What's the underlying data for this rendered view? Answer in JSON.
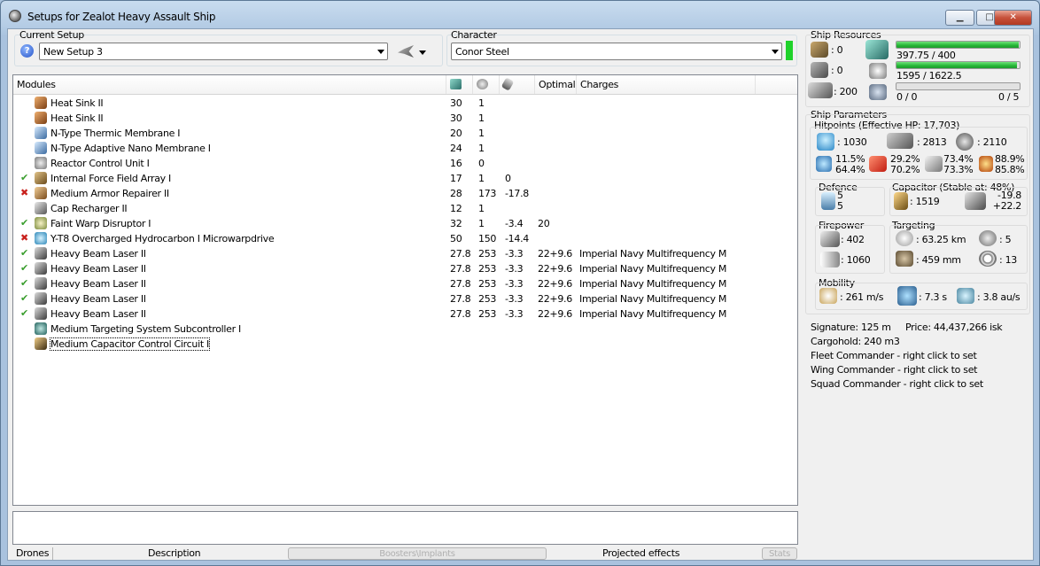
{
  "window": {
    "title": "Setups for Zealot Heavy Assault Ship",
    "minimize": "▁",
    "maximize": "□",
    "close": "✕"
  },
  "current_setup": {
    "label": "Current Setup",
    "value": "New Setup 3"
  },
  "character": {
    "label": "Character",
    "value": "Conor Steel",
    "indicator_color": "#1fd22a"
  },
  "modules": {
    "headers": {
      "name": "Modules",
      "optimal": "Optimal",
      "charges": "Charges"
    },
    "rows": [
      {
        "status": "",
        "icon": "heat-sink-icon",
        "name": "Heat Sink II",
        "cpu": "30",
        "power": "1",
        "cap": "",
        "optimal": "",
        "charges": ""
      },
      {
        "status": "",
        "icon": "heat-sink-icon",
        "name": "Heat Sink II",
        "cpu": "30",
        "power": "1",
        "cap": "",
        "optimal": "",
        "charges": ""
      },
      {
        "status": "",
        "icon": "membrane-icon",
        "name": "N-Type Thermic Membrane I",
        "cpu": "20",
        "power": "1",
        "cap": "",
        "optimal": "",
        "charges": ""
      },
      {
        "status": "",
        "icon": "membrane-icon",
        "name": "N-Type Adaptive Nano Membrane I",
        "cpu": "24",
        "power": "1",
        "cap": "",
        "optimal": "",
        "charges": ""
      },
      {
        "status": "",
        "icon": "reactor-control-icon",
        "name": "Reactor Control Unit I",
        "cpu": "16",
        "power": "0",
        "cap": "",
        "optimal": "",
        "charges": ""
      },
      {
        "status": "✔",
        "icon": "force-field-icon",
        "name": "Internal Force Field Array I",
        "cpu": "17",
        "power": "1",
        "cap": "0",
        "optimal": "",
        "charges": ""
      },
      {
        "status": "✖",
        "icon": "armor-repairer-icon",
        "name": "Medium Armor Repairer II",
        "cpu": "28",
        "power": "173",
        "cap": "-17.8",
        "optimal": "",
        "charges": ""
      },
      {
        "status": "",
        "icon": "cap-recharger-icon",
        "name": "Cap Recharger II",
        "cpu": "12",
        "power": "1",
        "cap": "",
        "optimal": "",
        "charges": ""
      },
      {
        "status": "✔",
        "icon": "warp-disruptor-icon",
        "name": "Faint Warp Disruptor I",
        "cpu": "32",
        "power": "1",
        "cap": "-3.4",
        "optimal": "20",
        "charges": ""
      },
      {
        "status": "✖",
        "icon": "microwarpdrive-icon",
        "name": "Y-T8 Overcharged Hydrocarbon I Microwarpdrive",
        "cpu": "50",
        "power": "150",
        "cap": "-14.4",
        "optimal": "",
        "charges": ""
      },
      {
        "status": "✔",
        "icon": "beam-laser-icon",
        "name": "Heavy Beam Laser II",
        "cpu": "27.8",
        "power": "253",
        "cap": "-3.3",
        "optimal": "22+9.6",
        "charges": "Imperial Navy Multifrequency M"
      },
      {
        "status": "✔",
        "icon": "beam-laser-icon",
        "name": "Heavy Beam Laser II",
        "cpu": "27.8",
        "power": "253",
        "cap": "-3.3",
        "optimal": "22+9.6",
        "charges": "Imperial Navy Multifrequency M"
      },
      {
        "status": "✔",
        "icon": "beam-laser-icon",
        "name": "Heavy Beam Laser II",
        "cpu": "27.8",
        "power": "253",
        "cap": "-3.3",
        "optimal": "22+9.6",
        "charges": "Imperial Navy Multifrequency M"
      },
      {
        "status": "✔",
        "icon": "beam-laser-icon",
        "name": "Heavy Beam Laser II",
        "cpu": "27.8",
        "power": "253",
        "cap": "-3.3",
        "optimal": "22+9.6",
        "charges": "Imperial Navy Multifrequency M"
      },
      {
        "status": "✔",
        "icon": "beam-laser-icon",
        "name": "Heavy Beam Laser II",
        "cpu": "27.8",
        "power": "253",
        "cap": "-3.3",
        "optimal": "22+9.6",
        "charges": "Imperial Navy Multifrequency M"
      },
      {
        "status": "",
        "icon": "targeting-subcontroller-icon",
        "name": "Medium Targeting System Subcontroller I",
        "cpu": "",
        "power": "",
        "cap": "",
        "optimal": "",
        "charges": ""
      },
      {
        "status": "",
        "icon": "capacitor-circuit-icon",
        "name": "Medium Capacitor Control Circuit I",
        "cpu": "",
        "power": "",
        "cap": "",
        "optimal": "",
        "charges": ""
      }
    ]
  },
  "tabs": {
    "drones": "Drones",
    "description": "Description",
    "boosters": "Boosters\\Implants",
    "projected": "Projected effects",
    "stats": "Stats"
  },
  "resources": {
    "title": "Ship Resources",
    "hardpoints": [
      ": 0",
      ": 0",
      ": 200"
    ],
    "cpu_text": "397.75 / 400",
    "cpu_fill": 0.99,
    "power_text": "1595 / 1622.5",
    "power_fill": 0.98,
    "drone_text": "0 / 0",
    "drone_count": "0 / 5",
    "drone_fill": 0
  },
  "params": {
    "title": "Ship Parameters",
    "hitpoints_title": "Hitpoints (Effective HP: 17,703)",
    "shield_hp": ": 1030",
    "armor_hp": ": 2813",
    "structure_hp": ": 2110",
    "res1": [
      "11.5%",
      "64.4%"
    ],
    "res2": [
      "29.2%",
      "70.2%"
    ],
    "res3": [
      "73.4%",
      "73.3%"
    ],
    "res4": [
      "88.9%",
      "85.8%"
    ],
    "defence_title": "Defence",
    "defence": [
      "5",
      "5"
    ],
    "capacitor_title": "Capacitor (Stable at: 48%)",
    "capacitor_value": ": 1519",
    "capacitor_delta": [
      "-19.8",
      "+22.2"
    ],
    "firepower_title": "Firepower",
    "firepower_volley": ": 402",
    "firepower_dps": ": 1060",
    "targeting_title": "Targeting",
    "target_range": ": 63.25 km",
    "max_targets": ": 5",
    "scan_res": ": 459 mm",
    "sensor": ": 13",
    "mobility_title": "Mobility",
    "speed": ": 261 m/s",
    "align": ": 7.3 s",
    "warp": ": 3.8 au/s"
  },
  "info": {
    "signature": "Signature: 125 m",
    "price": "Price: 44,437,266 isk",
    "cargohold": "Cargohold: 240 m3",
    "fleet": "Fleet Commander - right click to set",
    "wing": "Wing Commander - right click to set",
    "squad": "Squad Commander - right click to set"
  }
}
